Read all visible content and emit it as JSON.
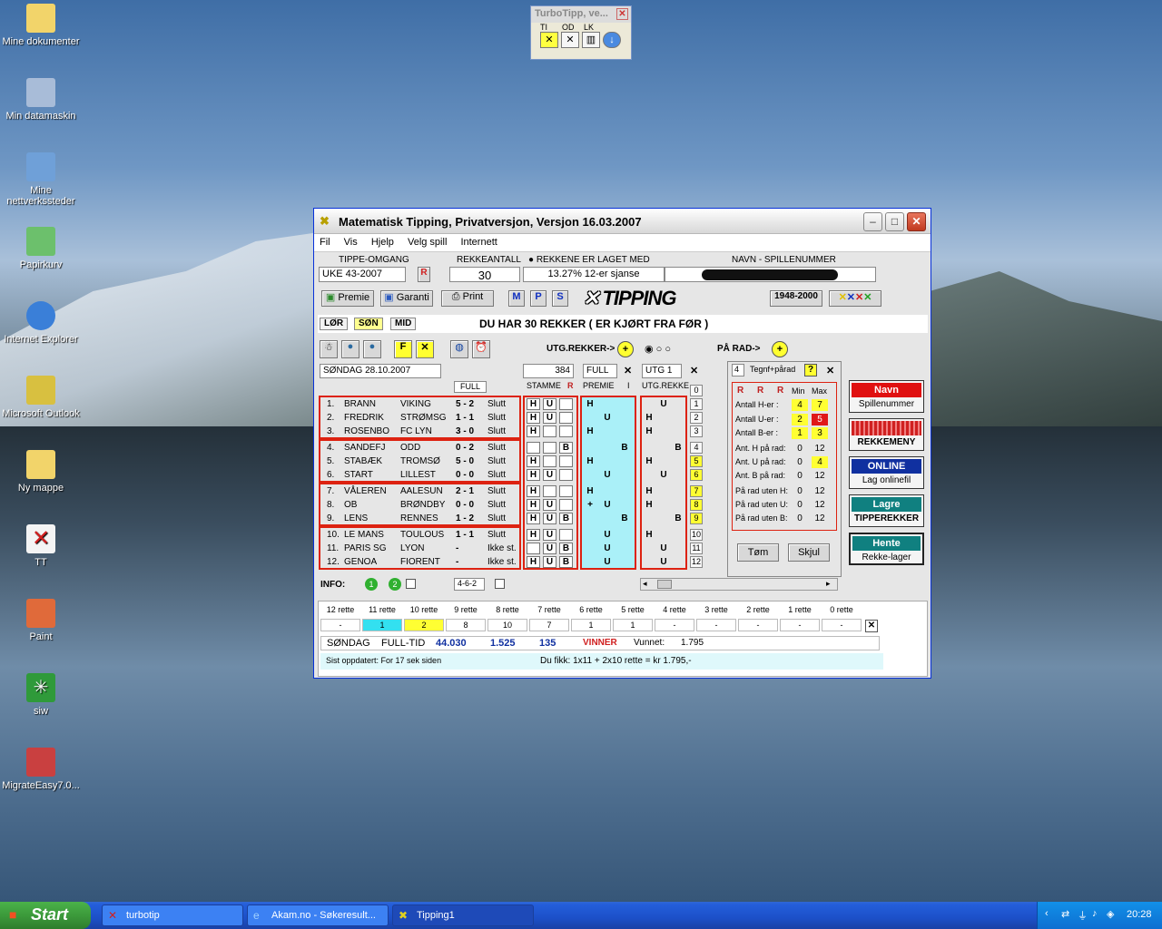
{
  "desktop_icons": [
    {
      "label": "Mine dokumenter",
      "icon": "folder-documents-icon"
    },
    {
      "label": "Min datamaskin",
      "icon": "computer-icon"
    },
    {
      "label": "Mine nettverkssteder",
      "icon": "network-places-icon"
    },
    {
      "label": "Papirkurv",
      "icon": "recycle-bin-icon"
    },
    {
      "label": "Internet Explorer",
      "icon": "internet-explorer-icon"
    },
    {
      "label": "Microsoft Outlook",
      "icon": "outlook-icon"
    },
    {
      "label": "Ny mappe",
      "icon": "folder-icon"
    },
    {
      "label": "TT",
      "icon": "tt-shortcut-icon"
    },
    {
      "label": "Paint",
      "icon": "paint-icon"
    },
    {
      "label": "siw",
      "icon": "siw-icon"
    },
    {
      "label": "MigrateEasy7.0...",
      "icon": "migrateeasy-icon"
    }
  ],
  "turbotipp": {
    "title": "TurboTipp, ve...",
    "labels": [
      "TI",
      "OD",
      "LK"
    ]
  },
  "window": {
    "title": "Matematisk Tipping, Privatversjon, Versjon 16.03.2007",
    "menu": [
      "Fil",
      "Vis",
      "Hjelp",
      "Velg spill",
      "Internett"
    ],
    "tippe_label": "TIPPE-OMGANG",
    "tippe_value": "UKE 43-2007",
    "rekke_label": "REKKEANTALL",
    "rekke_value": "30",
    "laget_label": "REKKENE ER LAGET MED",
    "laget_value": "13.27%  12-er sjanse",
    "navn_label": "NAVN  -  SPILLENUMMER",
    "btn_premie": "Premie",
    "btn_garanti": "Garanti",
    "btn_print": "Print",
    "btn_m": "M",
    "btn_p": "P",
    "btn_s": "S",
    "logo": "TIPPING",
    "btn_years": "1948-2000",
    "tabs": [
      "LØR",
      "SØN",
      "MID"
    ],
    "status_msg": "DU HAR 30 REKKER ( ER KJØRT FRA FØR )",
    "utg_rekker": "UTG.REKKER->",
    "pa_rad": "PÅ RAD->",
    "date": "SØNDAG 28.10.2007",
    "count": "384",
    "full": "FULL",
    "utg1": "UTG 1",
    "tegn": "4",
    "tegn_label": "Tegnf+pårad",
    "col_full": "FULL",
    "col_stamme": "STAMME",
    "col_premie": "PREMIE",
    "col_i": "I",
    "col_utg": "UTG.REKKE",
    "info_label": "INFO:",
    "info_value": "4-6-2",
    "btn_tom": "Tøm",
    "btn_skjul": "Skjul"
  },
  "matches": [
    {
      "n": "1.",
      "home": "BRANN",
      "away": "VIKING",
      "score": "5 - 2",
      "status": "Slutt",
      "s": [
        "H",
        "U",
        ""
      ],
      "p": [
        "H",
        "",
        ""
      ],
      "u": [
        "",
        "U",
        ""
      ],
      "r": "1"
    },
    {
      "n": "2.",
      "home": "FREDRIK",
      "away": "STRØMSG",
      "score": "1 - 1",
      "status": "Slutt",
      "s": [
        "H",
        "U",
        ""
      ],
      "p": [
        "",
        "U",
        ""
      ],
      "u": [
        "H",
        "",
        ""
      ],
      "r": "2"
    },
    {
      "n": "3.",
      "home": "ROSENBO",
      "away": "FC LYN",
      "score": "3 - 0",
      "status": "Slutt",
      "s": [
        "H",
        "",
        ""
      ],
      "p": [
        "H",
        "",
        ""
      ],
      "u": [
        "H",
        "",
        ""
      ],
      "r": "3"
    },
    {
      "n": "4.",
      "home": "SANDEFJ",
      "away": "ODD",
      "score": "0 - 2",
      "status": "Slutt",
      "s": [
        "",
        "",
        "B"
      ],
      "p": [
        "",
        "",
        "B"
      ],
      "u": [
        "",
        "",
        "B"
      ],
      "r": "4"
    },
    {
      "n": "5.",
      "home": "STABÆK",
      "away": "TROMSØ",
      "score": "5 - 0",
      "status": "Slutt",
      "s": [
        "H",
        "",
        ""
      ],
      "p": [
        "H",
        "",
        ""
      ],
      "u": [
        "H",
        "",
        ""
      ],
      "r": "5"
    },
    {
      "n": "6.",
      "home": "START",
      "away": "LILLEST",
      "score": "0 - 0",
      "status": "Slutt",
      "s": [
        "H",
        "U",
        ""
      ],
      "p": [
        "",
        "U",
        ""
      ],
      "u": [
        "",
        "U",
        ""
      ],
      "r": "6"
    },
    {
      "n": "7.",
      "home": "VÅLEREN",
      "away": "AALESUN",
      "score": "2 - 1",
      "status": "Slutt",
      "s": [
        "H",
        "",
        ""
      ],
      "p": [
        "H",
        "",
        ""
      ],
      "u": [
        "H",
        "",
        ""
      ],
      "r": "7"
    },
    {
      "n": "8.",
      "home": "OB",
      "away": "BRØNDBY",
      "score": "0 - 0",
      "status": "Slutt",
      "s": [
        "H",
        "U",
        ""
      ],
      "p": [
        "+",
        "U",
        ""
      ],
      "u": [
        "H",
        "",
        ""
      ],
      "r": "8"
    },
    {
      "n": "9.",
      "home": "LENS",
      "away": "RENNES",
      "score": "1 - 2",
      "status": "Slutt",
      "s": [
        "H",
        "U",
        "B"
      ],
      "p": [
        "",
        "",
        "B"
      ],
      "u": [
        "",
        "",
        "B"
      ],
      "r": "9"
    },
    {
      "n": "10.",
      "home": "LE MANS",
      "away": "TOULOUS",
      "score": "1 - 1",
      "status": "Slutt",
      "s": [
        "H",
        "U",
        ""
      ],
      "p": [
        "",
        "U",
        ""
      ],
      "u": [
        "H",
        "",
        ""
      ],
      "r": "10"
    },
    {
      "n": "11.",
      "home": "PARIS SG",
      "away": "LYON",
      "score": "-",
      "status": "Ikke st.",
      "s": [
        "",
        "U",
        "B"
      ],
      "p": [
        "",
        "U",
        ""
      ],
      "u": [
        "",
        "U",
        ""
      ],
      "r": "11"
    },
    {
      "n": "12.",
      "home": "GENOA",
      "away": "FIORENT",
      "score": "-",
      "status": "Ikke st.",
      "s": [
        "H",
        "U",
        "B"
      ],
      "p": [
        "",
        "U",
        ""
      ],
      "u": [
        "",
        "U",
        ""
      ],
      "r": "12"
    }
  ],
  "stats": {
    "head_min": "Min",
    "head_max": "Max",
    "rows": [
      {
        "label": "Antall  H-er :",
        "min": "4",
        "max": "7"
      },
      {
        "label": "Antall  U-er :",
        "min": "2",
        "max": "5"
      },
      {
        "label": "Antall  B-er :",
        "min": "1",
        "max": "3"
      },
      {
        "label": "Ant. H på rad:",
        "min": "0",
        "max": "12"
      },
      {
        "label": "Ant. U på rad:",
        "min": "0",
        "max": "4"
      },
      {
        "label": "Ant. B på rad:",
        "min": "0",
        "max": "12"
      },
      {
        "label": "På rad uten H:",
        "min": "0",
        "max": "12"
      },
      {
        "label": "På rad uten U:",
        "min": "0",
        "max": "12"
      },
      {
        "label": "På rad uten B:",
        "min": "0",
        "max": "12"
      }
    ]
  },
  "side_buttons": [
    {
      "top": "Navn",
      "bottom": "Spillenummer",
      "color": "#e01010"
    },
    {
      "top": "",
      "bottom": "REKKEMENY",
      "color": "#d02020"
    },
    {
      "top": "ONLINE",
      "bottom": "Lag onlinefil",
      "color": "#1030a0"
    },
    {
      "top": "Lagre",
      "bottom": "TIPPEREKKER",
      "color": "#108080"
    },
    {
      "top": "Hente",
      "bottom": "Rekke-lager",
      "color": "#108080"
    }
  ],
  "results": {
    "headers": [
      "12 rette",
      "11 rette",
      "10 rette",
      "9 rette",
      "8 rette",
      "7 rette",
      "6 rette",
      "5 rette",
      "4 rette",
      "3 rette",
      "2 rette",
      "1 rette",
      "0 rette"
    ],
    "values": [
      "-",
      "1",
      "2",
      "8",
      "10",
      "7",
      "1",
      "1",
      "-",
      "-",
      "-",
      "-",
      "-"
    ],
    "day": "SØNDAG",
    "type": "FULL-TID",
    "v1": "44.030",
    "v2": "1.525",
    "v3": "135",
    "winner": "VINNER",
    "won_label": "Vunnet:",
    "won_value": "1.795",
    "updated": "Sist oppdatert: For 17 sek siden",
    "summary": "Du fikk: 1x11 + 2x10  rette = kr 1.795,-"
  },
  "taskbar": {
    "start": "Start",
    "tasks": [
      "turbotip",
      "Akam.no - Søkeresult...",
      "Tipping1"
    ],
    "clock": "20:28"
  }
}
